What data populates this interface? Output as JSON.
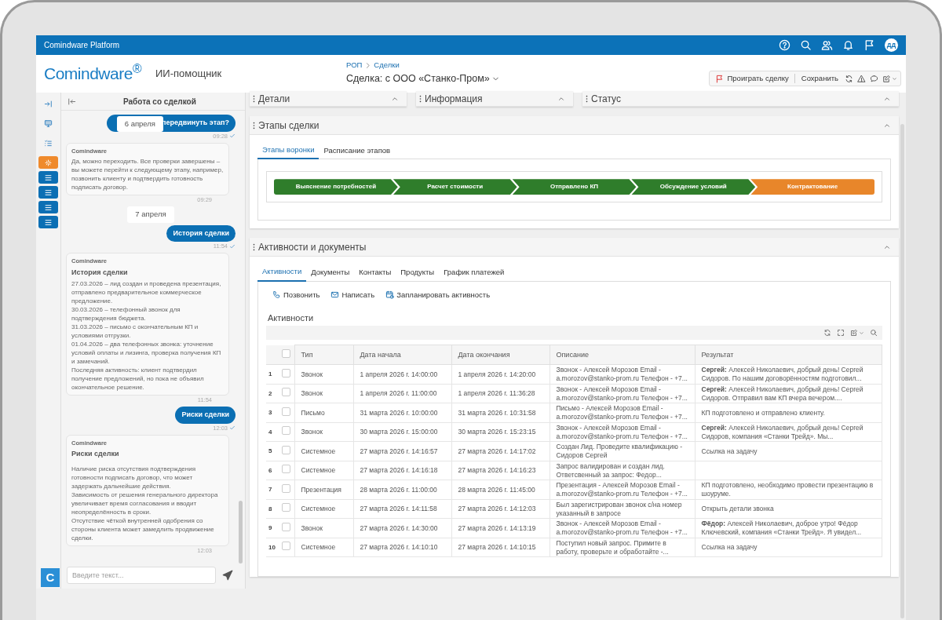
{
  "top_bar": {
    "title": "Comindware Platform",
    "avatar": "ДД"
  },
  "header": {
    "logo": "Comindware$^{®}$",
    "assistant": "ИИ-помощник",
    "breadcrumbs": [
      "РОП",
      "Сделки"
    ],
    "title": "Сделка: с ООО «Станко-Пром»",
    "lose_button": "Проиграть сделку",
    "save_button": "Сохранить"
  },
  "rail": [
    {
      "kind": "expand",
      "selected": false
    },
    {
      "kind": "monitor",
      "selected": false
    },
    {
      "kind": "checklist",
      "selected": false
    },
    {
      "kind": "sparkle",
      "selected": true
    },
    {
      "kind": "menu",
      "selected": false
    },
    {
      "kind": "menu",
      "selected": false
    },
    {
      "kind": "menu",
      "selected": false
    },
    {
      "kind": "menu",
      "selected": false
    }
  ],
  "app_badge": "C",
  "chat": {
    "title": "Работа со сделкой",
    "sticky_date": "6 апреля",
    "input_placeholder": "Введите текст...",
    "messages": [
      {
        "kind": "user",
        "text": "передвинуть этап?",
        "time": "09:28",
        "read": true
      },
      {
        "kind": "bot",
        "sender": "Comindware",
        "text": "Да, можно переходить. Все проверки завершены – вы можете перейти к следующему этапу, например, позвонить клиенту и подтвердить готовность подписать договор.",
        "time": "09:29"
      },
      {
        "kind": "date",
        "text": "7 апреля"
      },
      {
        "kind": "user",
        "text": "История сделки",
        "time": "11:54",
        "read": true
      },
      {
        "kind": "bot",
        "sender": "Comindware",
        "title": "История сделки",
        "text": "27.03.2026 – лид создан и проведена презентация, отправлено предварительное коммерческое предложение.\n30.03.2026 – телефонный звонок для подтверждения бюджета.\n31.03.2026 – письмо с окончательным КП и условиями отгрузки.\n01.04.2026 – два телефонных звонка: уточнение условий оплаты и лизинга, проверка получения КП и замечаний.\nПоследняя активность: клиент подтвердил получение предложений, но пока не объявил окончательное решение.",
        "time": "11:54"
      },
      {
        "kind": "user",
        "text": "Риски сделки",
        "time": "12:03",
        "read": true
      },
      {
        "kind": "bot",
        "sender": "Comindware",
        "title": "Риски сделки",
        "text": "Наличие риска отсутствия подтверждения готовности подписать договор, что может задержать дальнейшие действия.\nЗависимость от решения генерального директора увеличивает время согласования и вводит неопределённость в сроки.\nОтсутствие чёткой внутренней одобрения со стороны клиента может замедлить продвижение сделки.",
        "time": "12:03"
      }
    ]
  },
  "collapsed_panels": [
    "Детали",
    "Информация",
    "Статус"
  ],
  "stages_panel": {
    "title": "Этапы сделки",
    "tabs": [
      {
        "label": "Этапы воронки",
        "selected": true
      },
      {
        "label": "Расписание этапов",
        "selected": false
      }
    ],
    "stages": [
      {
        "label": "Выяснение потребностей",
        "current": false
      },
      {
        "label": "Расчет стоимости",
        "current": false
      },
      {
        "label": "Отправлено КП",
        "current": false
      },
      {
        "label": "Обсуждение условий",
        "current": false
      },
      {
        "label": "Контрактование",
        "current": true
      }
    ]
  },
  "activities_panel": {
    "title": "Активности и документы",
    "tabs": [
      {
        "label": "Активности",
        "selected": true
      },
      {
        "label": "Документы",
        "selected": false
      },
      {
        "label": "Контакты",
        "selected": false
      },
      {
        "label": "Продукты",
        "selected": false
      },
      {
        "label": "График платежей",
        "selected": false
      }
    ],
    "actions": [
      {
        "kind": "phone",
        "label": "Позвонить"
      },
      {
        "kind": "mail",
        "label": "Написать"
      },
      {
        "kind": "calendar",
        "label": "Запланировать активность"
      }
    ],
    "section_title": "Активности",
    "table": {
      "header_checked": false,
      "columns": [
        "Тип",
        "Дата начала",
        "Дата окончания",
        "Описание",
        "Результат"
      ],
      "rows": [
        {
          "num": "1",
          "checked": false,
          "type": "Звонок",
          "start": "1 апреля 2026 г. 14:00:00",
          "end": "1 апреля 2026 г. 14:20:00",
          "description": "Звонок - Алексей Морозов Email - a.morozov@stanko-prom.ru Телефон - +7...",
          "result": "**Сергей:** Алексей Николаевич, добрый день! Сергей Сидоров. По нашим договорённостям подготовил..."
        },
        {
          "num": "2",
          "checked": false,
          "type": "Звонок",
          "start": "1 апреля 2026 г. 11:00:00",
          "end": "1 апреля 2026 г. 11:36:28",
          "description": "Звонок - Алексей Морозов Email - a.morozov@stanko-prom.ru Телефон - +7...",
          "result": "**Сергей:** Алексей Николаевич, добрый день! Сергей Сидоров. Отправил вам КП вчера вечером...."
        },
        {
          "num": "3",
          "checked": false,
          "type": "Письмо",
          "start": "31 марта 2026 г. 10:00:00",
          "end": "31 марта 2026 г. 10:31:58",
          "description": "Письмо - Алексей Морозов Email - a.morozov@stanko-prom.ru Телефон - +7...",
          "result": "КП подготовлено и отправлено клиенту."
        },
        {
          "num": "4",
          "checked": false,
          "type": "Звонок",
          "start": "30 марта 2026 г. 15:00:00",
          "end": "30 марта 2026 г. 15:23:15",
          "description": "Звонок - Алексей Морозов Email - a.morozov@stanko-prom.ru Телефон - +7...",
          "result": "**Сергей:** Алексей Николаевич, добрый день! Сергей Сидоров, компания «Станки Трейд». Мы..."
        },
        {
          "num": "5",
          "checked": false,
          "type": "Системное",
          "start": "27 марта 2026 г. 14:16:57",
          "end": "27 марта 2026 г. 14:17:02",
          "description": "Создан Лид. Проведите квалификацию - Сидоров Сергей",
          "result": "Ссылка на задачу"
        },
        {
          "num": "6",
          "checked": false,
          "type": "Системное",
          "start": "27 марта 2026 г. 14:16:18",
          "end": "27 марта 2026 г. 14:16:23",
          "description": "Запрос валидирован и создан лид. Ответсвенный за запрос: Федор..."
        },
        {
          "num": "7",
          "checked": false,
          "type": "Презентация",
          "start": "28 марта 2026 г. 11:00:00",
          "end": "28 марта 2026 г. 11:45:00",
          "description": "Презентация - Алексей Морозов Email - a.morozov@stanko-prom.ru Телефон - +7...",
          "result": "КП подготовлено, необходимо провести презентацию в шоуруме."
        },
        {
          "num": "8",
          "checked": false,
          "type": "Системное",
          "start": "27 марта 2026 г. 14:11:58",
          "end": "27 марта 2026 г. 14:12:03",
          "description": "Был зарегистрирован звонок с/на номер указанный в запросе",
          "result": "Открыть детали звонка"
        },
        {
          "num": "9",
          "checked": false,
          "type": "Звонок",
          "start": "27 марта 2026 г. 14:30:00",
          "end": "27 марта 2026 г. 14:13:19",
          "description": "Звонок - Алексей Морозов Email - a.morozov@stanko-prom.ru Телефон - +7...",
          "result": "**Фёдор:** Алексей Николаевич, доброе утро! Фёдор Ключевский, компания «Станки Трейд». Я увидел..."
        },
        {
          "num": "10",
          "checked": false,
          "type": "Системное",
          "start": "27 марта 2026 г. 14:10:10",
          "end": "27 марта 2026 г. 14:10:15",
          "description": "Поступил новый запрос. Примите в работу, проверьте и обработайте -...",
          "result": "Ссылка на задачу"
        }
      ]
    }
  }
}
